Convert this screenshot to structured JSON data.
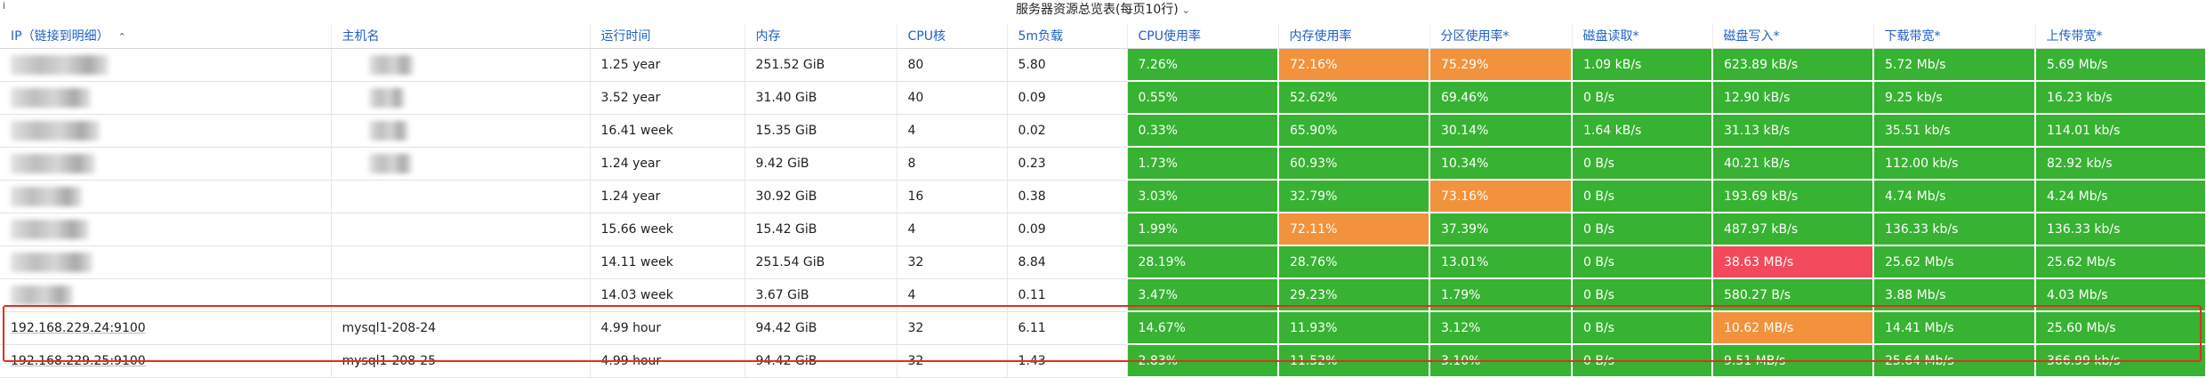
{
  "panel": {
    "info_mark": "i",
    "title": "服务器资源总览表(每页10行)",
    "title_chevron": "⌄"
  },
  "columns": [
    {
      "label": "IP（链接到明细）",
      "sort": "⌃"
    },
    {
      "label": "主机名"
    },
    {
      "label": "运行时间"
    },
    {
      "label": "内存"
    },
    {
      "label": "CPU核"
    },
    {
      "label": "5m负载"
    },
    {
      "label": "CPU使用率"
    },
    {
      "label": "内存使用率"
    },
    {
      "label": "分区使用率*"
    },
    {
      "label": "磁盘读取*"
    },
    {
      "label": "磁盘写入*"
    },
    {
      "label": "下载带宽*"
    },
    {
      "label": "上传带宽*"
    }
  ],
  "rows": [
    {
      "ip": "",
      "host": "",
      "uptime": "1.25 year",
      "memory": "251.52 GiB",
      "cpu": "80",
      "load": "5.80",
      "cpu_use": "7.26%",
      "mem_use": "72.16%",
      "part_use": "75.29%",
      "disk_read": "1.09 kB/s",
      "disk_write": "623.89 kB/s",
      "down": "5.72 Mb/s",
      "up": "5.69 Mb/s"
    },
    {
      "ip": "",
      "host": "",
      "uptime": "3.52 year",
      "memory": "31.40 GiB",
      "cpu": "40",
      "load": "0.09",
      "cpu_use": "0.55%",
      "mem_use": "52.62%",
      "part_use": "69.46%",
      "disk_read": "0 B/s",
      "disk_write": "12.90 kB/s",
      "down": "9.25 kb/s",
      "up": "16.23 kb/s"
    },
    {
      "ip": "",
      "host": "",
      "uptime": "16.41 week",
      "memory": "15.35 GiB",
      "cpu": "4",
      "load": "0.02",
      "cpu_use": "0.33%",
      "mem_use": "65.90%",
      "part_use": "30.14%",
      "disk_read": "1.64 kB/s",
      "disk_write": "31.13 kB/s",
      "down": "35.51 kb/s",
      "up": "114.01 kb/s"
    },
    {
      "ip": "",
      "host": "",
      "uptime": "1.24 year",
      "memory": "9.42 GiB",
      "cpu": "8",
      "load": "0.23",
      "cpu_use": "1.73%",
      "mem_use": "60.93%",
      "part_use": "10.34%",
      "disk_read": "0 B/s",
      "disk_write": "40.21 kB/s",
      "down": "112.00 kb/s",
      "up": "82.92 kb/s"
    },
    {
      "ip": "",
      "host": "",
      "uptime": "1.24 year",
      "memory": "30.92 GiB",
      "cpu": "16",
      "load": "0.38",
      "cpu_use": "3.03%",
      "mem_use": "32.79%",
      "part_use": "73.16%",
      "disk_read": "0 B/s",
      "disk_write": "193.69 kB/s",
      "down": "4.74 Mb/s",
      "up": "4.24 Mb/s"
    },
    {
      "ip": "",
      "host": "",
      "uptime": "15.66 week",
      "memory": "15.42 GiB",
      "cpu": "4",
      "load": "0.09",
      "cpu_use": "1.99%",
      "mem_use": "72.11%",
      "part_use": "37.39%",
      "disk_read": "0 B/s",
      "disk_write": "487.97 kB/s",
      "down": "136.33 kb/s",
      "up": "136.33 kb/s"
    },
    {
      "ip": "",
      "host": "",
      "uptime": "14.11 week",
      "memory": "251.54 GiB",
      "cpu": "32",
      "load": "8.84",
      "cpu_use": "28.19%",
      "mem_use": "28.76%",
      "part_use": "13.01%",
      "disk_read": "0 B/s",
      "disk_write": "38.63 MB/s",
      "down": "25.62 Mb/s",
      "up": "25.62 Mb/s"
    },
    {
      "ip": "",
      "host": "",
      "uptime": "14.03 week",
      "memory": "3.67 GiB",
      "cpu": "4",
      "load": "0.11",
      "cpu_use": "3.47%",
      "mem_use": "29.23%",
      "part_use": "1.79%",
      "disk_read": "0 B/s",
      "disk_write": "580.27 B/s",
      "down": "3.88 Mb/s",
      "up": "4.03 Mb/s"
    },
    {
      "ip": "192.168.229.24:9100",
      "host": "mysql1-208-24",
      "uptime": "4.99 hour",
      "memory": "94.42 GiB",
      "cpu": "32",
      "load": "6.11",
      "cpu_use": "14.67%",
      "mem_use": "11.93%",
      "part_use": "3.12%",
      "disk_read": "0 B/s",
      "disk_write": "10.62 MB/s",
      "down": "14.41 Mb/s",
      "up": "25.60 Mb/s"
    },
    {
      "ip": "192.168.229.25:9100",
      "host": "mysql1-208-25",
      "uptime": "4.99 hour",
      "memory": "94.42 GiB",
      "cpu": "32",
      "load": "1.43",
      "cpu_use": "2.83%",
      "mem_use": "11.52%",
      "part_use": "3.10%",
      "disk_read": "0 B/s",
      "disk_write": "9.51 MB/s",
      "down": "25.64 Mb/s",
      "up": "366.99 kb/s"
    }
  ],
  "cell_colors": {
    "mem_use": [
      "orange",
      "green",
      "green",
      "green",
      "green",
      "orange",
      "green",
      "green",
      "green",
      "green"
    ],
    "part_use": [
      "orange",
      "green",
      "green",
      "green",
      "orange",
      "green",
      "green",
      "green",
      "green",
      "green"
    ],
    "disk_write": [
      "green",
      "green",
      "green",
      "green",
      "green",
      "green",
      "red",
      "green",
      "orange",
      "green"
    ]
  },
  "colors": {
    "green": "#37b232",
    "orange": "#f2923c",
    "red": "#f2495c",
    "header_text": "#1f60c4",
    "highlight_border": "#e0301e"
  }
}
